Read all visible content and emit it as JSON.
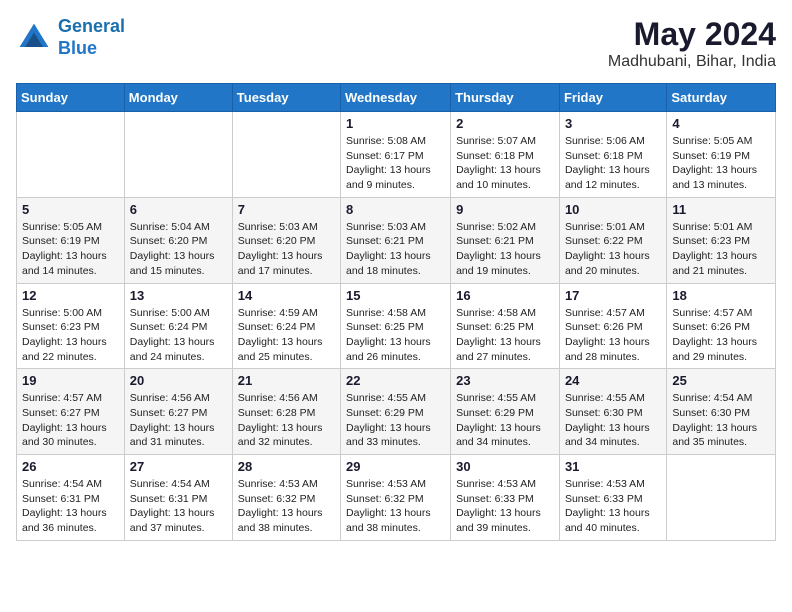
{
  "header": {
    "logo_line1": "General",
    "logo_line2": "Blue",
    "title": "May 2024",
    "subtitle": "Madhubani, Bihar, India"
  },
  "days_of_week": [
    "Sunday",
    "Monday",
    "Tuesday",
    "Wednesday",
    "Thursday",
    "Friday",
    "Saturday"
  ],
  "weeks": [
    [
      {
        "day": "",
        "info": ""
      },
      {
        "day": "",
        "info": ""
      },
      {
        "day": "",
        "info": ""
      },
      {
        "day": "1",
        "info": "Sunrise: 5:08 AM\nSunset: 6:17 PM\nDaylight: 13 hours\nand 9 minutes."
      },
      {
        "day": "2",
        "info": "Sunrise: 5:07 AM\nSunset: 6:18 PM\nDaylight: 13 hours\nand 10 minutes."
      },
      {
        "day": "3",
        "info": "Sunrise: 5:06 AM\nSunset: 6:18 PM\nDaylight: 13 hours\nand 12 minutes."
      },
      {
        "day": "4",
        "info": "Sunrise: 5:05 AM\nSunset: 6:19 PM\nDaylight: 13 hours\nand 13 minutes."
      }
    ],
    [
      {
        "day": "5",
        "info": "Sunrise: 5:05 AM\nSunset: 6:19 PM\nDaylight: 13 hours\nand 14 minutes."
      },
      {
        "day": "6",
        "info": "Sunrise: 5:04 AM\nSunset: 6:20 PM\nDaylight: 13 hours\nand 15 minutes."
      },
      {
        "day": "7",
        "info": "Sunrise: 5:03 AM\nSunset: 6:20 PM\nDaylight: 13 hours\nand 17 minutes."
      },
      {
        "day": "8",
        "info": "Sunrise: 5:03 AM\nSunset: 6:21 PM\nDaylight: 13 hours\nand 18 minutes."
      },
      {
        "day": "9",
        "info": "Sunrise: 5:02 AM\nSunset: 6:21 PM\nDaylight: 13 hours\nand 19 minutes."
      },
      {
        "day": "10",
        "info": "Sunrise: 5:01 AM\nSunset: 6:22 PM\nDaylight: 13 hours\nand 20 minutes."
      },
      {
        "day": "11",
        "info": "Sunrise: 5:01 AM\nSunset: 6:23 PM\nDaylight: 13 hours\nand 21 minutes."
      }
    ],
    [
      {
        "day": "12",
        "info": "Sunrise: 5:00 AM\nSunset: 6:23 PM\nDaylight: 13 hours\nand 22 minutes."
      },
      {
        "day": "13",
        "info": "Sunrise: 5:00 AM\nSunset: 6:24 PM\nDaylight: 13 hours\nand 24 minutes."
      },
      {
        "day": "14",
        "info": "Sunrise: 4:59 AM\nSunset: 6:24 PM\nDaylight: 13 hours\nand 25 minutes."
      },
      {
        "day": "15",
        "info": "Sunrise: 4:58 AM\nSunset: 6:25 PM\nDaylight: 13 hours\nand 26 minutes."
      },
      {
        "day": "16",
        "info": "Sunrise: 4:58 AM\nSunset: 6:25 PM\nDaylight: 13 hours\nand 27 minutes."
      },
      {
        "day": "17",
        "info": "Sunrise: 4:57 AM\nSunset: 6:26 PM\nDaylight: 13 hours\nand 28 minutes."
      },
      {
        "day": "18",
        "info": "Sunrise: 4:57 AM\nSunset: 6:26 PM\nDaylight: 13 hours\nand 29 minutes."
      }
    ],
    [
      {
        "day": "19",
        "info": "Sunrise: 4:57 AM\nSunset: 6:27 PM\nDaylight: 13 hours\nand 30 minutes."
      },
      {
        "day": "20",
        "info": "Sunrise: 4:56 AM\nSunset: 6:27 PM\nDaylight: 13 hours\nand 31 minutes."
      },
      {
        "day": "21",
        "info": "Sunrise: 4:56 AM\nSunset: 6:28 PM\nDaylight: 13 hours\nand 32 minutes."
      },
      {
        "day": "22",
        "info": "Sunrise: 4:55 AM\nSunset: 6:29 PM\nDaylight: 13 hours\nand 33 minutes."
      },
      {
        "day": "23",
        "info": "Sunrise: 4:55 AM\nSunset: 6:29 PM\nDaylight: 13 hours\nand 34 minutes."
      },
      {
        "day": "24",
        "info": "Sunrise: 4:55 AM\nSunset: 6:30 PM\nDaylight: 13 hours\nand 34 minutes."
      },
      {
        "day": "25",
        "info": "Sunrise: 4:54 AM\nSunset: 6:30 PM\nDaylight: 13 hours\nand 35 minutes."
      }
    ],
    [
      {
        "day": "26",
        "info": "Sunrise: 4:54 AM\nSunset: 6:31 PM\nDaylight: 13 hours\nand 36 minutes."
      },
      {
        "day": "27",
        "info": "Sunrise: 4:54 AM\nSunset: 6:31 PM\nDaylight: 13 hours\nand 37 minutes."
      },
      {
        "day": "28",
        "info": "Sunrise: 4:53 AM\nSunset: 6:32 PM\nDaylight: 13 hours\nand 38 minutes."
      },
      {
        "day": "29",
        "info": "Sunrise: 4:53 AM\nSunset: 6:32 PM\nDaylight: 13 hours\nand 38 minutes."
      },
      {
        "day": "30",
        "info": "Sunrise: 4:53 AM\nSunset: 6:33 PM\nDaylight: 13 hours\nand 39 minutes."
      },
      {
        "day": "31",
        "info": "Sunrise: 4:53 AM\nSunset: 6:33 PM\nDaylight: 13 hours\nand 40 minutes."
      },
      {
        "day": "",
        "info": ""
      }
    ]
  ]
}
